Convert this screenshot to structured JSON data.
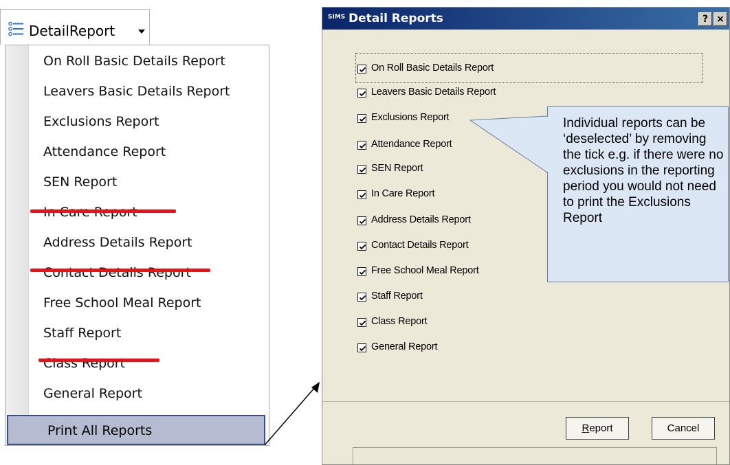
{
  "menu": {
    "title": "DetailReport",
    "items": [
      {
        "label": "On Roll Basic Details Report",
        "struck": false
      },
      {
        "label": "Leavers Basic Details Report",
        "struck": false
      },
      {
        "label": "Exclusions Report",
        "struck": false
      },
      {
        "label": "Attendance Report",
        "struck": false
      },
      {
        "label": "SEN Report",
        "struck": false
      },
      {
        "label": "In Care Report",
        "struck": true
      },
      {
        "label": "Address Details Report",
        "struck": false
      },
      {
        "label": "Contact Details Report",
        "struck": true
      },
      {
        "label": "Free School Meal Report",
        "struck": false
      },
      {
        "label": "Staff Report",
        "struck": false
      },
      {
        "label": "Class Report",
        "struck": true
      },
      {
        "label": "General Report",
        "struck": false
      }
    ],
    "print_all_label": "Print All Reports",
    "strike_color": "#e4141b"
  },
  "dialog": {
    "app_badge": "SIMS",
    "title": "Detail Reports",
    "help_button": "?",
    "close_button": "×",
    "checkboxes": [
      {
        "label": "On Roll Basic Details Report",
        "checked": true
      },
      {
        "label": "Leavers Basic Details Report",
        "checked": true
      },
      {
        "label": "Exclusions Report",
        "checked": true
      },
      {
        "label": "Attendance Report",
        "checked": true
      },
      {
        "label": "SEN Report",
        "checked": true
      },
      {
        "label": "In Care Report",
        "checked": true
      },
      {
        "label": "Address Details Report",
        "checked": true
      },
      {
        "label": "Contact Details Report",
        "checked": true
      },
      {
        "label": "Free School Meal Report",
        "checked": true
      },
      {
        "label": "Staff Report",
        "checked": true
      },
      {
        "label": "Class Report",
        "checked": true
      },
      {
        "label": "General Report",
        "checked": true
      }
    ],
    "report_button": "Report",
    "cancel_button": "Cancel"
  },
  "callout": {
    "text": "Individual reports can be ‘deselected’ by removing the tick e.g. if there were no exclusions in the reporting period you would not need to print the Exclusions Report"
  }
}
